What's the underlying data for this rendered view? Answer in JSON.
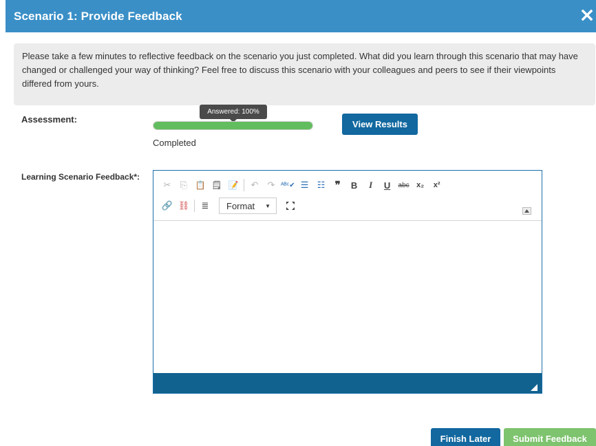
{
  "dialog": {
    "title": "Scenario 1: Provide Feedback",
    "close_icon": "close-x-icon",
    "instructions": "Please take a few minutes to reflective feedback on the scenario you just completed. What did you learn through this scenario that may have changed or challenged your way of thinking? Feel free to discuss this scenario with your colleagues and peers to see if their viewpoints differed from yours."
  },
  "assessment": {
    "label": "Assessment:",
    "tooltip": "Answered: 100%",
    "progress_percent": 100,
    "status": "Completed",
    "view_results_label": "View Results"
  },
  "feedback": {
    "label": "Learning Scenario Feedback*:",
    "value": ""
  },
  "editor": {
    "toolbar_row1": [
      {
        "name": "cut-icon",
        "glyph": "✂",
        "enabled": false
      },
      {
        "name": "copy-icon",
        "glyph": "⎘",
        "enabled": false
      },
      {
        "name": "paste-icon",
        "glyph": "📋",
        "enabled": true
      },
      {
        "name": "paste-text-icon",
        "glyph": "🗒",
        "enabled": true
      },
      {
        "name": "paste-word-icon",
        "glyph": "📝",
        "enabled": true
      },
      {
        "name": "undo-icon",
        "glyph": "↶",
        "enabled": false
      },
      {
        "name": "redo-icon",
        "glyph": "↷",
        "enabled": false
      },
      {
        "name": "spellcheck-icon",
        "glyph": "ᴬᴮᶜ✔",
        "enabled": true
      },
      {
        "name": "numbered-list-icon",
        "glyph": "☰",
        "enabled": true
      },
      {
        "name": "bulleted-list-icon",
        "glyph": "☷",
        "enabled": true
      },
      {
        "name": "blockquote-icon",
        "glyph": "❞",
        "enabled": true
      },
      {
        "name": "bold-icon",
        "glyph": "B",
        "enabled": true
      },
      {
        "name": "italic-icon",
        "glyph": "I",
        "enabled": true
      },
      {
        "name": "underline-icon",
        "glyph": "U",
        "enabled": true
      },
      {
        "name": "strikethrough-icon",
        "glyph": "abc",
        "enabled": true
      },
      {
        "name": "subscript-icon",
        "glyph": "x₂",
        "enabled": true
      },
      {
        "name": "superscript-icon",
        "glyph": "x²",
        "enabled": true
      }
    ],
    "toolbar_row2": [
      {
        "name": "link-icon",
        "glyph": "🔗",
        "enabled": true
      },
      {
        "name": "unlink-icon",
        "glyph": "⛓",
        "enabled": true
      },
      {
        "name": "text-format-icon",
        "glyph": "≣",
        "enabled": true
      }
    ],
    "format_dropdown_label": "Format",
    "maximize_icon": "maximize-icon",
    "collapse_icon": "collapse-toolbar-icon"
  },
  "buttons": {
    "finish_later": "Finish Later",
    "submit_feedback": "Submit Feedback"
  },
  "colors": {
    "header_blue": "#3a8fc7",
    "button_blue": "#12689f",
    "progress_green": "#62bd5e",
    "submit_green": "#7ec36e",
    "editor_status_bar": "#12628f"
  }
}
